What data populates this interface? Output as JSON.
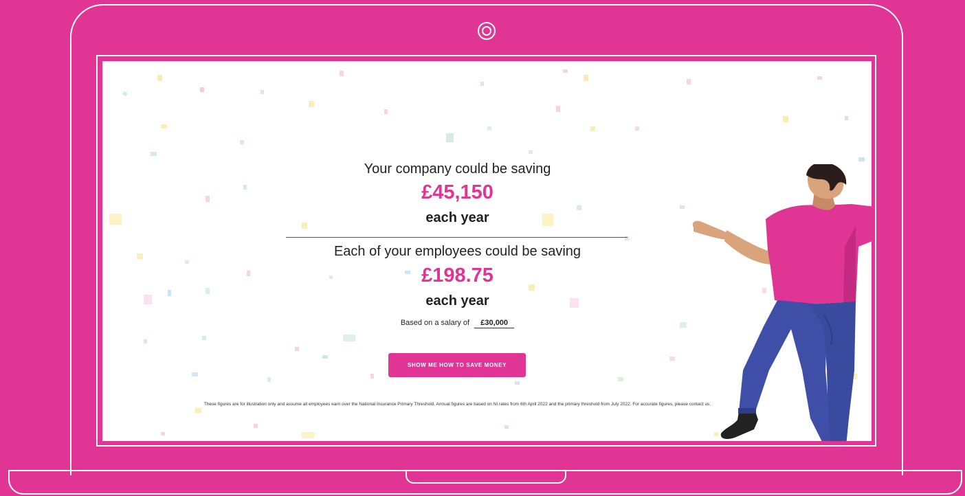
{
  "savings": {
    "company_heading": "Your company could be saving",
    "company_amount": "£45,150",
    "company_period": "each year",
    "employee_heading": "Each of your employees could be saving",
    "employee_amount": "£198.75",
    "employee_period": "each year"
  },
  "salary": {
    "label": "Based on a salary of",
    "value": "£30,000"
  },
  "cta": {
    "label": "SHOW ME HOW TO SAVE MONEY"
  },
  "disclaimer": "These figures are for illustration only and assume all employees earn over the National Insurance Primary Threshold. Annual figures are based on NI rates from 6th April 2022 and the primary threshold from July 2022. For accurate figures, please contact us.",
  "colors": {
    "background": "#e03594",
    "accent": "#e03594",
    "text": "#222222"
  }
}
